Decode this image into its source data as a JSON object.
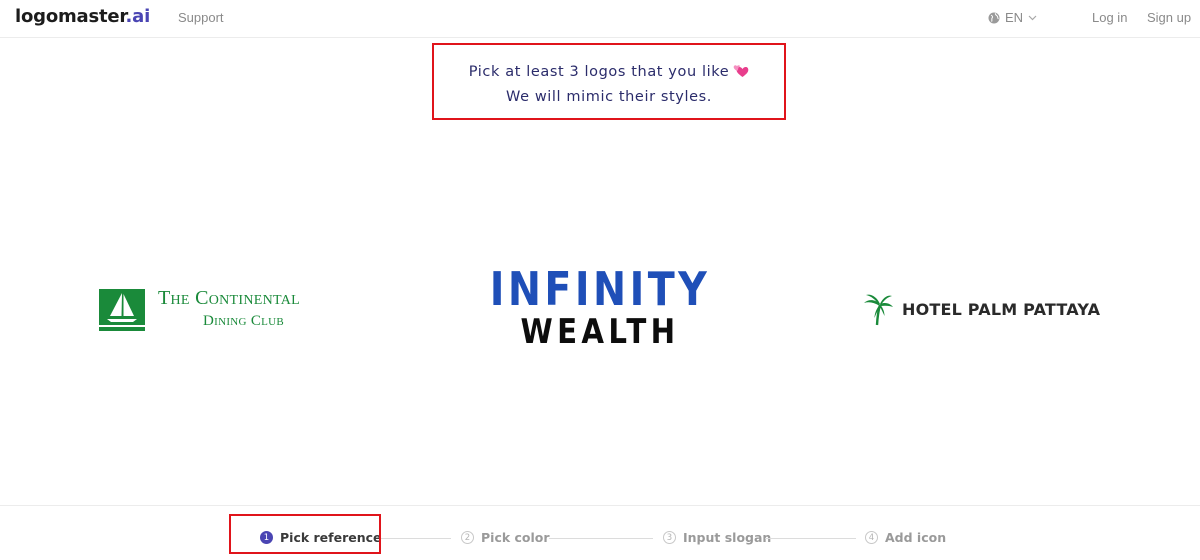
{
  "header": {
    "brand_name": "logomaster",
    "brand_tld": ".ai",
    "support_label": "Support",
    "language": {
      "icon": "globe-icon",
      "label": "EN",
      "chevron": "chevron-down-icon"
    },
    "login_label": "Log in",
    "signup_label": "Sign up"
  },
  "instruction": {
    "line1": "Pick at least 3 logos that you like",
    "line2": "We will mimic their styles.",
    "emoji_icon": "two-hearts-icon"
  },
  "logos": [
    {
      "id": "continental",
      "line1": "The Continental",
      "line2": "Dining Club",
      "icon": "sailboat-icon",
      "color": "#1a8a3a"
    },
    {
      "id": "infinity",
      "line1": "INFINITY",
      "line2": "WEALTH",
      "colors": [
        "#1f4fb8",
        "#0d0d0d"
      ]
    },
    {
      "id": "palm",
      "name": "HOTEL PALM PATTAYA",
      "icon": "palm-tree-icon",
      "color": "#1a8a3a"
    }
  ],
  "stepper": {
    "active_step": 1,
    "steps": [
      {
        "number": "1",
        "label": "Pick reference"
      },
      {
        "number": "2",
        "label": "Pick color"
      },
      {
        "number": "3",
        "label": "Input slogan"
      },
      {
        "number": "4",
        "label": "Add icon"
      }
    ]
  },
  "colors": {
    "accent": "#4a45b3",
    "highlight_border": "#e0141b",
    "instruction_text": "#2b2c6b"
  }
}
